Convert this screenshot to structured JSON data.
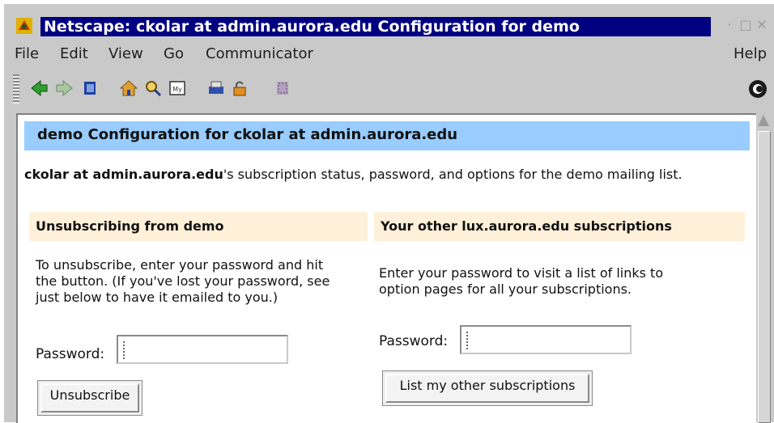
{
  "window": {
    "title": "Netscape: ckolar at admin.aurora.edu Configuration for demo",
    "controls": [
      "minimize",
      "maximize",
      "close"
    ]
  },
  "menubar": {
    "items": [
      "File",
      "Edit",
      "View",
      "Go",
      "Communicator"
    ],
    "help": "Help"
  },
  "toolbar": {
    "buttons": [
      "back-icon",
      "forward-icon",
      "reload-icon",
      "home-icon",
      "search-icon",
      "my-netscape-icon",
      "print-icon",
      "security-icon",
      "stop-icon"
    ],
    "throbber": "netscape-logo-icon"
  },
  "page": {
    "header": "demo Configuration for ckolar at admin.aurora.edu",
    "status": {
      "bold": "ckolar at admin.aurora.edu",
      "rest": "'s subscription status, password, and options for the demo mailing list."
    },
    "unsubscribe": {
      "heading": "Unsubscribing from demo",
      "line1": "To unsubscribe, enter your password and hit",
      "line2": "the button. (If you've lost your password, see",
      "line3": "just below to have it emailed to you.)",
      "password_label": "Password:",
      "password_value": "",
      "button": "Unsubscribe"
    },
    "other": {
      "heading": "Your other lux.aurora.edu subscriptions",
      "line1": "Enter your password to visit a list of links to",
      "line2": "option pages for all your subscriptions.",
      "password_label": "Password:",
      "password_value": "",
      "button": "List my other subscriptions"
    }
  },
  "colors": {
    "title_bar": "#000080",
    "header_bar": "#99ccff",
    "section_head": "#fff0d9",
    "chrome": "#c9c9c9"
  }
}
